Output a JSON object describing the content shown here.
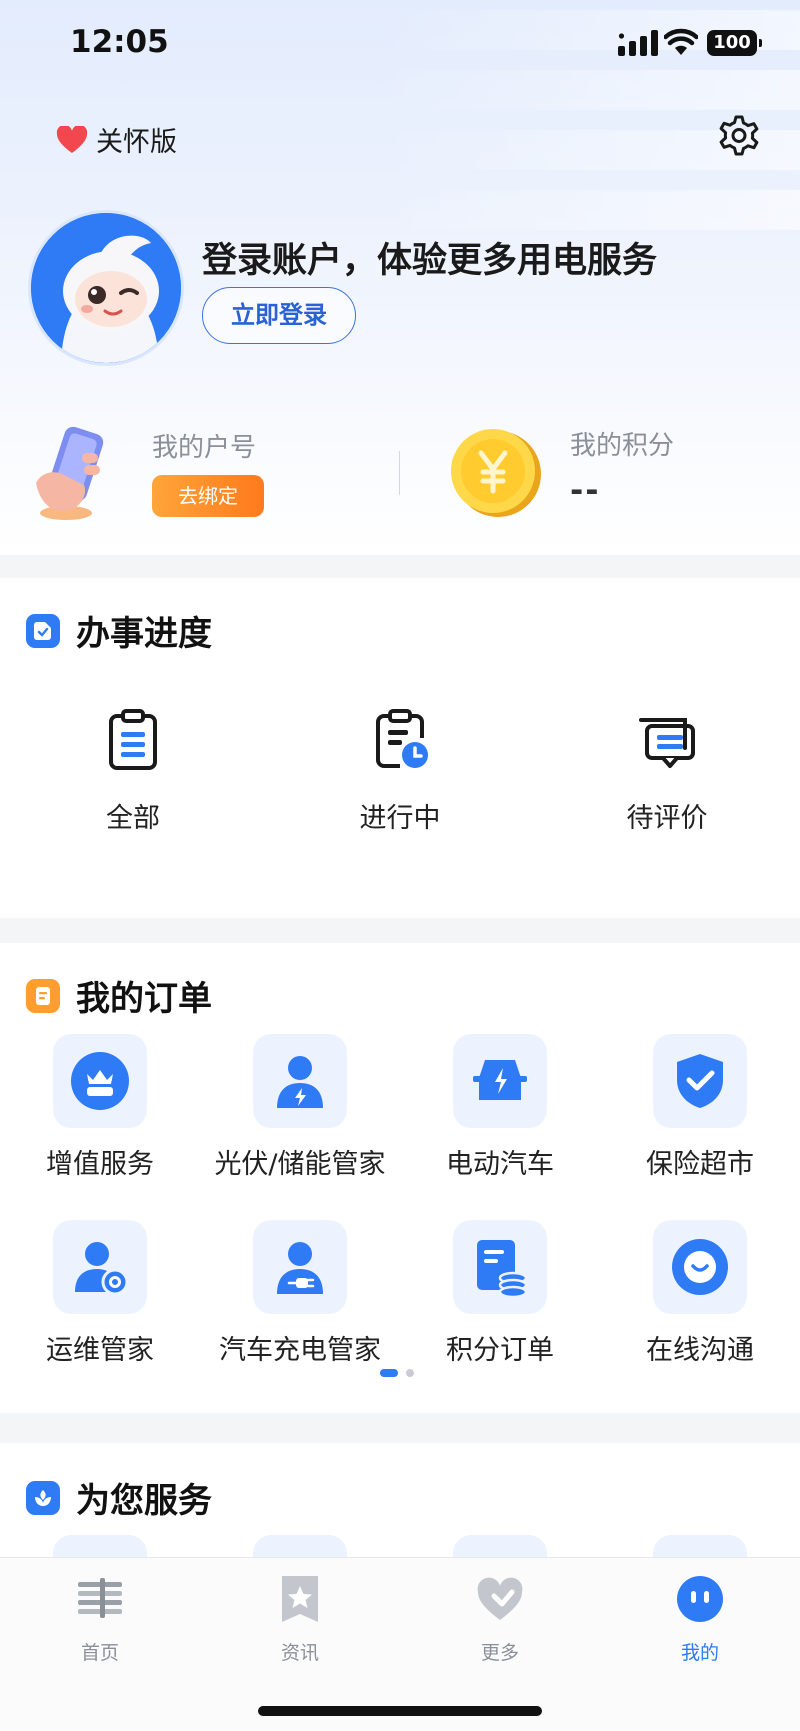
{
  "status_bar": {
    "time": "12:05",
    "battery": "100"
  },
  "header": {
    "care_mode_label": "关怀版"
  },
  "profile": {
    "login_prompt": "登录账户，体验更多用电服务",
    "login_button": "立即登录"
  },
  "account": {
    "account_label": "我的户号",
    "bind_button": "去绑定",
    "points_label": "我的积分",
    "points_value": "--"
  },
  "progress": {
    "title": "办事进度",
    "items": [
      {
        "label": "全部",
        "icon": "clipboard-list-icon"
      },
      {
        "label": "进行中",
        "icon": "clipboard-clock-icon"
      },
      {
        "label": "待评价",
        "icon": "message-stack-icon"
      }
    ]
  },
  "orders": {
    "title": "我的订单",
    "items": [
      {
        "label": "增值服务",
        "icon": "crown-basket-icon"
      },
      {
        "label": "光伏/储能管家",
        "icon": "user-bolt-icon"
      },
      {
        "label": "电动汽车",
        "icon": "car-bolt-icon"
      },
      {
        "label": "保险超市",
        "icon": "shield-check-icon"
      },
      {
        "label": "运维管家",
        "icon": "user-gear-icon"
      },
      {
        "label": "汽车充电管家",
        "icon": "user-plug-icon"
      },
      {
        "label": "积分订单",
        "icon": "document-coins-icon"
      },
      {
        "label": "在线沟通",
        "icon": "chat-smile-icon"
      }
    ],
    "page": 1,
    "pages": 2
  },
  "services": {
    "title": "为您服务"
  },
  "tabbar": {
    "items": [
      {
        "label": "首页",
        "icon": "home-icon"
      },
      {
        "label": "资讯",
        "icon": "news-star-icon"
      },
      {
        "label": "更多",
        "icon": "more-heart-icon"
      },
      {
        "label": "我的",
        "icon": "profile-face-icon"
      }
    ],
    "active": "我的"
  },
  "colors": {
    "accent": "#2f7bf6",
    "bind_orange": "#ff8a24",
    "tile_bg": "#edf3fe"
  }
}
